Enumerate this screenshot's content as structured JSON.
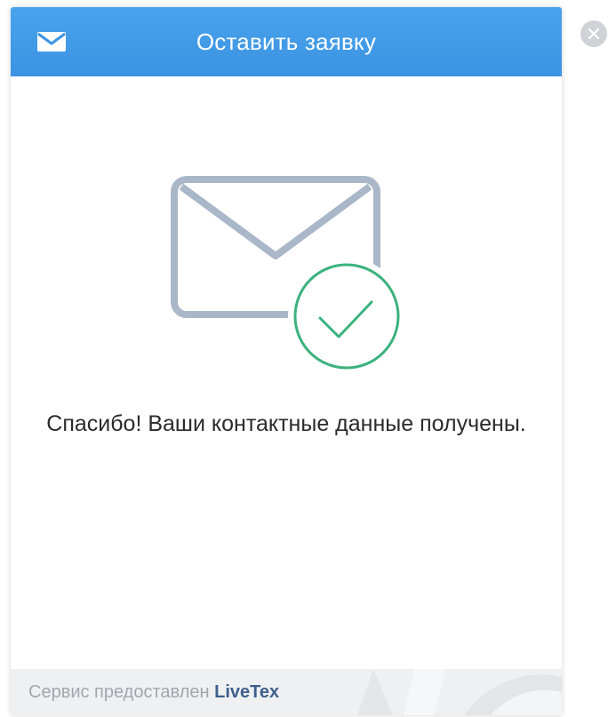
{
  "header": {
    "icon": "envelope-icon",
    "title": "Оставить заявку",
    "color": "#3b93e2"
  },
  "main": {
    "graphic_icon": "envelope-check-icon",
    "message": "Спасибо! Ваши контактные данные получены.",
    "check_color": "#3bb27d"
  },
  "footer": {
    "prefix": "Сервис предоставлен",
    "brand": "LiveTex"
  },
  "close_icon": "close-icon"
}
